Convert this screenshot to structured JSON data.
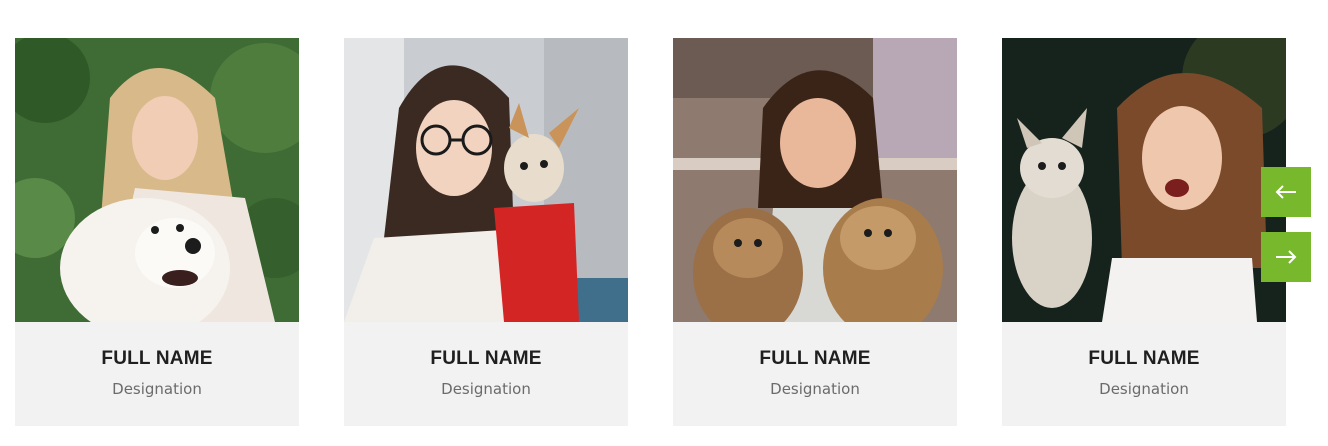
{
  "team": [
    {
      "name": "FULL NAME",
      "designation": "Designation",
      "photo": "woman-with-white-samoyed"
    },
    {
      "name": "FULL NAME",
      "designation": "Designation",
      "photo": "woman-with-chihuahua-in-red-sweater"
    },
    {
      "name": "FULL NAME",
      "designation": "Designation",
      "photo": "girl-with-two-yorkshire-terriers"
    },
    {
      "name": "FULL NAME",
      "designation": "Designation",
      "photo": "woman-with-chihuahua"
    }
  ],
  "nav": {
    "prev_icon": "arrow-left-icon",
    "next_icon": "arrow-right-icon",
    "accent_color": "#77b82d"
  },
  "colors": {
    "card_background": "#f2f2f2",
    "name_text": "#1f1f1f",
    "designation_text": "#6b6b6b"
  }
}
